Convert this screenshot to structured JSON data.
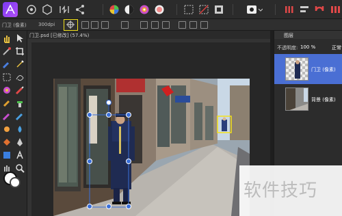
{
  "context_bar": {
    "layer_name": "门卫 (像素)",
    "dpi": "300dpi"
  },
  "document": {
    "tab_title": "门卫.psd [已修改] (57.4%)"
  },
  "layers_panel": {
    "title": "图层",
    "opacity_label": "不透明度:",
    "opacity_value": "100 %",
    "blend_mode": "正常",
    "layers": [
      {
        "name": "门卫",
        "type": "(像素)",
        "selected": true
      },
      {
        "name": "背景",
        "type": "(像素)",
        "selected": false
      }
    ]
  },
  "watermark": {
    "text": "软件技巧"
  },
  "colors": {
    "accent": "#4a6fd4",
    "highlight": "#f4e31a",
    "selection": "#3a6fd8"
  }
}
